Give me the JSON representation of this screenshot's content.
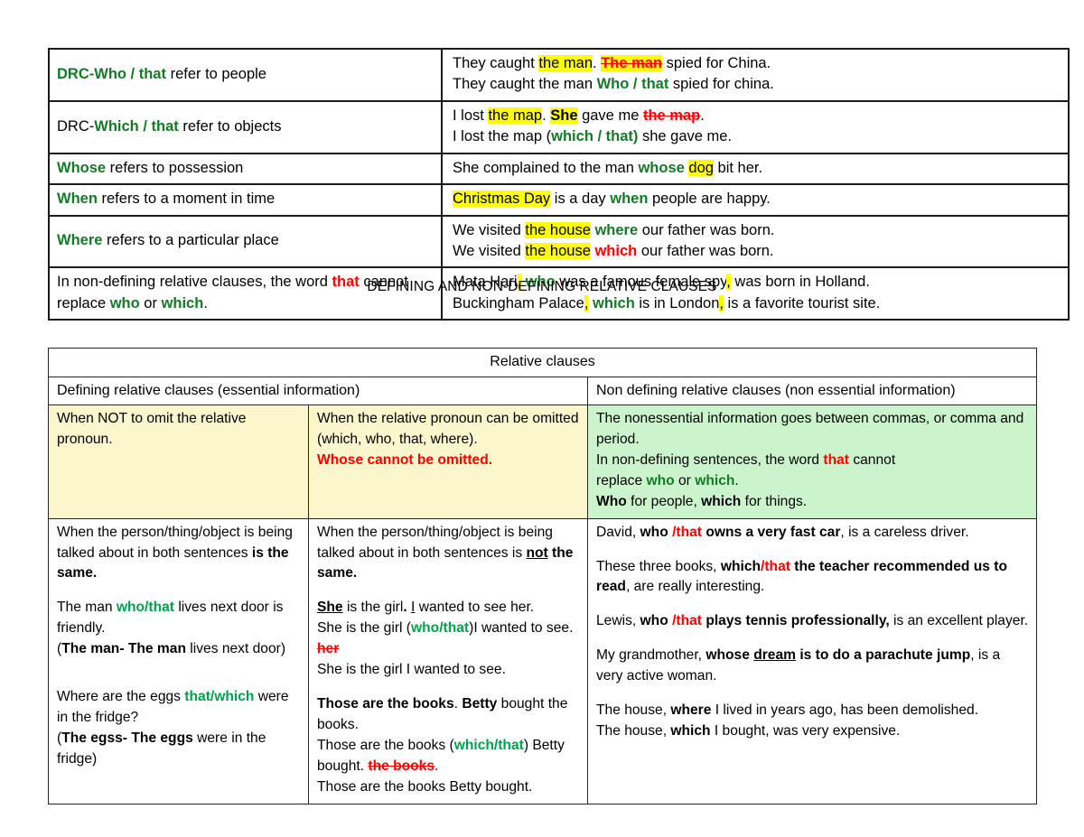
{
  "document": {
    "caption": "DEFINING AND NON-DEFINING RELATIVE CLAUSES",
    "colors": {
      "dark_green": "#147a27",
      "bright_green": "#00a14b",
      "red": "#ff0000",
      "highlight_yellow": "#ffff00",
      "cell_yellow": "#fcf6cd",
      "cell_green": "#ccf4cc",
      "border": "#1a1a1a"
    }
  },
  "table1": {
    "rows": [
      {
        "rule_parts": [
          {
            "text": "DRC-Who / that",
            "style": "green-bold"
          },
          {
            "text": " refer to people",
            "style": "plain"
          }
        ],
        "example_lines": [
          [
            {
              "text": "They caught ",
              "style": "plain"
            },
            {
              "text": "the man",
              "style": "highlight"
            },
            {
              "text": ". ",
              "style": "plain"
            },
            {
              "text": "The man",
              "style": "red-strike-highlight"
            },
            {
              "text": " spied for China.",
              "style": "plain"
            }
          ],
          [
            {
              "text": "They caught the man ",
              "style": "plain"
            },
            {
              "text": "Who / that",
              "style": "green-bold"
            },
            {
              "text": " spied for china.",
              "style": "plain"
            }
          ]
        ]
      },
      {
        "rule_parts": [
          {
            "text": "DRC-",
            "style": "plain"
          },
          {
            "text": "Which / that",
            "style": "green-bold"
          },
          {
            "text": " refer to objects",
            "style": "plain"
          }
        ],
        "example_lines": [
          [
            {
              "text": "I lost ",
              "style": "plain"
            },
            {
              "text": "the map",
              "style": "highlight"
            },
            {
              "text": ". ",
              "style": "plain"
            },
            {
              "text": "She",
              "style": "bold-highlight"
            },
            {
              "text": " gave me ",
              "style": "plain"
            },
            {
              "text": "the map",
              "style": "red-strike"
            },
            {
              "text": ".",
              "style": "plain"
            }
          ],
          [
            {
              "text": "I lost the map (",
              "style": "plain"
            },
            {
              "text": "which / that)",
              "style": "green-bold"
            },
            {
              "text": " she gave me.",
              "style": "plain"
            }
          ]
        ]
      },
      {
        "rule_parts": [
          {
            "text": "Whose",
            "style": "green-bold"
          },
          {
            "text": " refers to possession",
            "style": "plain"
          }
        ],
        "example_lines": [
          [
            {
              "text": "She complained to the man ",
              "style": "plain"
            },
            {
              "text": "whose",
              "style": "green-bold"
            },
            {
              "text": " ",
              "style": "plain"
            },
            {
              "text": "dog",
              "style": "highlight"
            },
            {
              "text": " bit her.",
              "style": "plain"
            }
          ]
        ]
      },
      {
        "rule_parts": [
          {
            "text": "When",
            "style": "green-bold"
          },
          {
            "text": " refers to a moment in time",
            "style": "plain"
          }
        ],
        "example_lines": [
          [
            {
              "text": "Christmas Day",
              "style": "highlight"
            },
            {
              "text": " is a day ",
              "style": "plain"
            },
            {
              "text": "when",
              "style": "green-bold"
            },
            {
              "text": " people are happy.",
              "style": "plain"
            }
          ]
        ]
      },
      {
        "rule_parts": [
          {
            "text": "Where",
            "style": "green-bold"
          },
          {
            "text": " refers to a particular place",
            "style": "plain"
          }
        ],
        "example_lines": [
          [
            {
              "text": "We visited ",
              "style": "plain"
            },
            {
              "text": "the house",
              "style": "highlight"
            },
            {
              "text": " ",
              "style": "plain"
            },
            {
              "text": "where",
              "style": "green-bold"
            },
            {
              "text": " our father was born.",
              "style": "plain"
            }
          ],
          [
            {
              "text": "We visited ",
              "style": "plain"
            },
            {
              "text": "the house",
              "style": "highlight"
            },
            {
              "text": " ",
              "style": "plain"
            },
            {
              "text": "which",
              "style": "red-bold"
            },
            {
              "text": " our father was born.",
              "style": "plain"
            }
          ]
        ]
      },
      {
        "rule_parts": [
          {
            "text": "In non-defining relative clauses, the word ",
            "style": "plain"
          },
          {
            "text": "that",
            "style": "red-bold"
          },
          {
            "text": " cannot replace ",
            "style": "plain"
          },
          {
            "text": "who",
            "style": "green-bold"
          },
          {
            "text": " or ",
            "style": "plain"
          },
          {
            "text": "which",
            "style": "green-bold"
          },
          {
            "text": ".",
            "style": "plain"
          }
        ],
        "example_lines": [
          [
            {
              "text": "Mata Hari",
              "style": "plain"
            },
            {
              "text": ",",
              "style": "highlight"
            },
            {
              "text": " ",
              "style": "plain"
            },
            {
              "text": "who",
              "style": "green-bold"
            },
            {
              "text": " was a famous female spy",
              "style": "plain"
            },
            {
              "text": ",",
              "style": "highlight"
            },
            {
              "text": " was born in Holland.",
              "style": "plain"
            }
          ],
          [
            {
              "text": "Buckingham   Palace",
              "style": "plain"
            },
            {
              "text": ",",
              "style": "highlight"
            },
            {
              "text": " ",
              "style": "plain"
            },
            {
              "text": "which",
              "style": "green-bold"
            },
            {
              "text": " is in London",
              "style": "plain"
            },
            {
              "text": ",",
              "style": "highlight"
            },
            {
              "text": " is a favorite tourist site.",
              "style": "plain"
            }
          ]
        ]
      }
    ]
  },
  "table2": {
    "title": "Relative clauses",
    "subheaders": [
      "Defining relative clauses (essential information)",
      "Non defining relative clauses (non essential information)"
    ],
    "summary_row": {
      "left": [
        [
          {
            "text": "When NOT to omit the relative pronoun.",
            "style": "plain"
          }
        ]
      ],
      "middle": [
        [
          {
            "text": "When the relative pronoun can be omitted",
            "style": "plain"
          }
        ],
        [
          {
            "text": "(which, who, that, where).",
            "style": "plain"
          }
        ],
        [
          {
            "text": "Whose cannot be omitted.",
            "style": "red-plain"
          }
        ]
      ],
      "right": [
        [
          {
            "text": "The nonessential information goes between commas, or comma and period.",
            "style": "plain"
          }
        ],
        [
          {
            "text": "In non-defining sentences, the word ",
            "style": "plain"
          },
          {
            "text": "that",
            "style": "red-bold"
          },
          {
            "text": " cannot",
            "style": "plain"
          }
        ],
        [
          {
            "text": "replace ",
            "style": "plain"
          },
          {
            "text": "who",
            "style": "green-bold"
          },
          {
            "text": " or ",
            "style": "plain"
          },
          {
            "text": "which",
            "style": "green-bold"
          },
          {
            "text": ".",
            "style": "plain"
          }
        ],
        [
          {
            "text": "Who",
            "style": "bold"
          },
          {
            "text": " for people, ",
            "style": "plain"
          },
          {
            "text": "which",
            "style": "bold"
          },
          {
            "text": " for things.",
            "style": "plain"
          }
        ]
      ]
    },
    "body_row": {
      "left": [
        [
          {
            "text": "When the person/thing/object is being talked about in both sentences ",
            "style": "plain"
          },
          {
            "text": "is the same.",
            "style": "bold"
          }
        ],
        [
          {
            "text": "",
            "style": "spacer"
          }
        ],
        [
          {
            "text": "The man ",
            "style": "plain"
          },
          {
            "text": "who/that",
            "style": "bright-green-bold"
          },
          {
            "text": " lives next door is friendly.",
            "style": "plain"
          }
        ],
        [
          {
            "text": "(",
            "style": "plain"
          },
          {
            "text": "The man-  The man",
            "style": "bold"
          },
          {
            "text": " lives next door)",
            "style": "plain"
          }
        ],
        [
          {
            "text": "",
            "style": "spacer"
          }
        ],
        [
          {
            "text": "",
            "style": "spacer"
          }
        ],
        [
          {
            "text": "Where are the eggs ",
            "style": "plain"
          },
          {
            "text": "that/which",
            "style": "bright-green-bold"
          },
          {
            "text": " were in the fridge?",
            "style": "plain"
          }
        ],
        [
          {
            "text": "(",
            "style": "plain"
          },
          {
            "text": "The egss- The eggs",
            "style": "bold"
          },
          {
            "text": " were in the fridge)",
            "style": "plain"
          }
        ]
      ],
      "middle": [
        [
          {
            "text": "When the person/thing/object is being talked about in both sentences is ",
            "style": "plain"
          },
          {
            "text": "not",
            "style": "bold-underline"
          },
          {
            "text": " the same.",
            "style": "bold"
          }
        ],
        [
          {
            "text": "",
            "style": "spacer"
          }
        ],
        [
          {
            "text": "She",
            "style": "bold-underline"
          },
          {
            "text": " is the girl",
            "style": "plain"
          },
          {
            "text": ". ",
            "style": "bold"
          },
          {
            "text": "I",
            "style": "underline"
          },
          {
            "text": " wanted to see her.",
            "style": "plain"
          }
        ],
        [
          {
            "text": "She is the girl (",
            "style": "plain"
          },
          {
            "text": "who/that",
            "style": "bright-green-bold"
          },
          {
            "text": ")I wanted to see. ",
            "style": "plain"
          },
          {
            "text": "her",
            "style": "red-strike"
          }
        ],
        [
          {
            "text": "She is the girl I wanted to see.",
            "style": "plain"
          }
        ],
        [
          {
            "text": "",
            "style": "spacer"
          }
        ],
        [
          {
            "text": "Those are the books",
            "style": "bold"
          },
          {
            "text": ". ",
            "style": "plain"
          },
          {
            "text": "Betty",
            "style": "bold"
          },
          {
            "text": " bought the books.",
            "style": "plain"
          }
        ],
        [
          {
            "text": "Those are the books (",
            "style": "plain"
          },
          {
            "text": "which/that",
            "style": "bright-green-bold"
          },
          {
            "text": ") Betty bought. ",
            "style": "plain"
          },
          {
            "text": "the books",
            "style": "red-strike"
          },
          {
            "text": ".",
            "style": "plain"
          }
        ],
        [
          {
            "text": "Those are the books Betty bought.",
            "style": "plain"
          }
        ]
      ],
      "right": [
        [
          {
            "text": "David, ",
            "style": "plain"
          },
          {
            "text": "who ",
            "style": "bold"
          },
          {
            "text": "/that",
            "style": "red-bold"
          },
          {
            "text": " owns a very fast car",
            "style": "bold"
          },
          {
            "text": ", is a careless driver.",
            "style": "plain"
          }
        ],
        [
          {
            "text": "",
            "style": "spacer"
          }
        ],
        [
          {
            "text": "These three books, ",
            "style": "plain"
          },
          {
            "text": "which",
            "style": "bold"
          },
          {
            "text": "/that",
            "style": "red-bold"
          },
          {
            "text": " the teacher recommended us to read",
            "style": "bold"
          },
          {
            "text": ", are really interesting.",
            "style": "plain"
          }
        ],
        [
          {
            "text": "",
            "style": "spacer"
          }
        ],
        [
          {
            "text": "Lewis, ",
            "style": "plain"
          },
          {
            "text": "who ",
            "style": "bold"
          },
          {
            "text": "/that",
            "style": "red-bold"
          },
          {
            "text": " plays tennis professionally,",
            "style": "bold"
          },
          {
            "text": " is an excellent player.",
            "style": "plain"
          }
        ],
        [
          {
            "text": "",
            "style": "spacer"
          }
        ],
        [
          {
            "text": "My grandmother, ",
            "style": "plain"
          },
          {
            "text": "whose ",
            "style": "bold"
          },
          {
            "text": "dream",
            "style": "bold-underline"
          },
          {
            "text": " is to do a parachute jump",
            "style": "bold"
          },
          {
            "text": ", is a very active woman.",
            "style": "plain"
          }
        ],
        [
          {
            "text": "",
            "style": "spacer"
          }
        ],
        [
          {
            "text": "The house, ",
            "style": "plain"
          },
          {
            "text": "where",
            "style": "bold"
          },
          {
            "text": " I lived in years ago, has been demolished.",
            "style": "plain"
          }
        ],
        [
          {
            "text": "The house, ",
            "style": "plain"
          },
          {
            "text": "which",
            "style": "bold"
          },
          {
            "text": " I bought, was very expensive.",
            "style": "plain"
          }
        ]
      ]
    }
  }
}
